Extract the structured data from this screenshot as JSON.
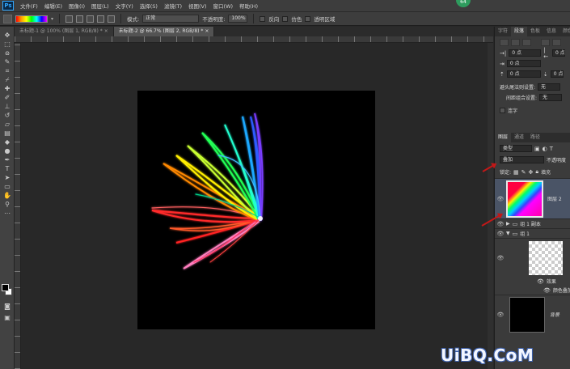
{
  "app": {
    "logo": "Ps",
    "badge": "64"
  },
  "menu": [
    "文件(F)",
    "编辑(E)",
    "图像(I)",
    "图层(L)",
    "文字(Y)",
    "选择(S)",
    "滤镜(T)",
    "视图(V)",
    "窗口(W)",
    "帮助(H)"
  ],
  "options": {
    "mode_label": "模式:",
    "mode_value": "正常",
    "opacity_label": "不透明度:",
    "opacity_value": "100%",
    "reverse_label": "反向",
    "dither_label": "仿色",
    "transparency_label": "透明区域"
  },
  "doc_tabs": [
    {
      "label": "未标题-1 @ 100% (图层 1, RGB/8) *"
    },
    {
      "label": "未标题-2 @ 66.7% (图层 2, RGB/8) *"
    }
  ],
  "panel_top": {
    "tabs": [
      "字符",
      "段落",
      "色板",
      "信息",
      "颜色"
    ],
    "indent_left": "0 点",
    "indent_right": "0 点",
    "indent_first": "0 点",
    "space_before": "0 点",
    "space_after": "0 点",
    "avoid_label": "避头尾法则设置:",
    "avoid_value": "无",
    "compose_label": "间距组合设置:",
    "compose_value": "无",
    "hyphen_label": "连字"
  },
  "layers_panel": {
    "tabs": [
      "图层",
      "通道",
      "路径"
    ],
    "filter_value": "类型",
    "blend_value": "叠加",
    "opacity_label": "不透明度",
    "lock_label": "锁定:",
    "fill_label": "填充"
  },
  "layers": [
    {
      "name": "图层 2"
    },
    {
      "name": "组 1 副本"
    },
    {
      "name": "组 1"
    },
    {
      "name": "效果"
    },
    {
      "name": "颜色叠加"
    },
    {
      "name": "背景"
    }
  ],
  "watermark": "UiBQ.CoM",
  "colors": {
    "accent": "#31a8ff",
    "arrow": "#c21818",
    "canvas": "#000000"
  }
}
